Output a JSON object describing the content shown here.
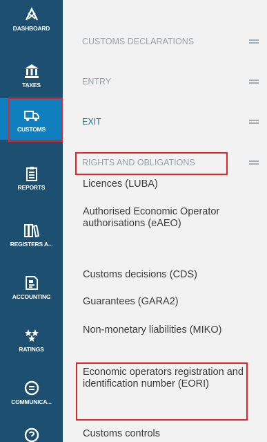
{
  "sidebar": {
    "items": [
      {
        "label": "DASHBOARD",
        "icon": "dashboard-icon"
      },
      {
        "label": "TAXES",
        "icon": "bank-icon"
      },
      {
        "label": "CUSTOMS",
        "icon": "truck-icon"
      },
      {
        "label": "REPORTS",
        "icon": "clipboard-icon"
      },
      {
        "label": "REGISTERS A...",
        "icon": "books-icon"
      },
      {
        "label": "ACCOUNTING",
        "icon": "calculator-icon"
      },
      {
        "label": "RATINGS",
        "icon": "stars-icon"
      },
      {
        "label": "COMMUNICA...",
        "icon": "chat-icon"
      },
      {
        "label": "",
        "icon": "help-icon"
      }
    ],
    "active": "CUSTOMS"
  },
  "menu": {
    "sections": [
      {
        "label": "CUSTOMS DECLARATIONS"
      },
      {
        "label": "ENTRY"
      },
      {
        "label": "EXIT"
      },
      {
        "label": "RIGHTS AND OBLIGATIONS"
      }
    ],
    "items": [
      "Licences (LUBA)",
      "Authorised Economic Operator authorisations (eAEO)",
      "Customs decisions (CDS)",
      "Guarantees (GARA2)",
      "Non-monetary liabilities (MIKO)",
      "Economic operators registration and identification number (EORI)",
      "Customs controls"
    ]
  },
  "colors": {
    "sidebar": "#1d4f70",
    "sidebar_active": "#0f7fbf",
    "highlight": "#e0262b",
    "exit_link": "#1a6fb0"
  }
}
